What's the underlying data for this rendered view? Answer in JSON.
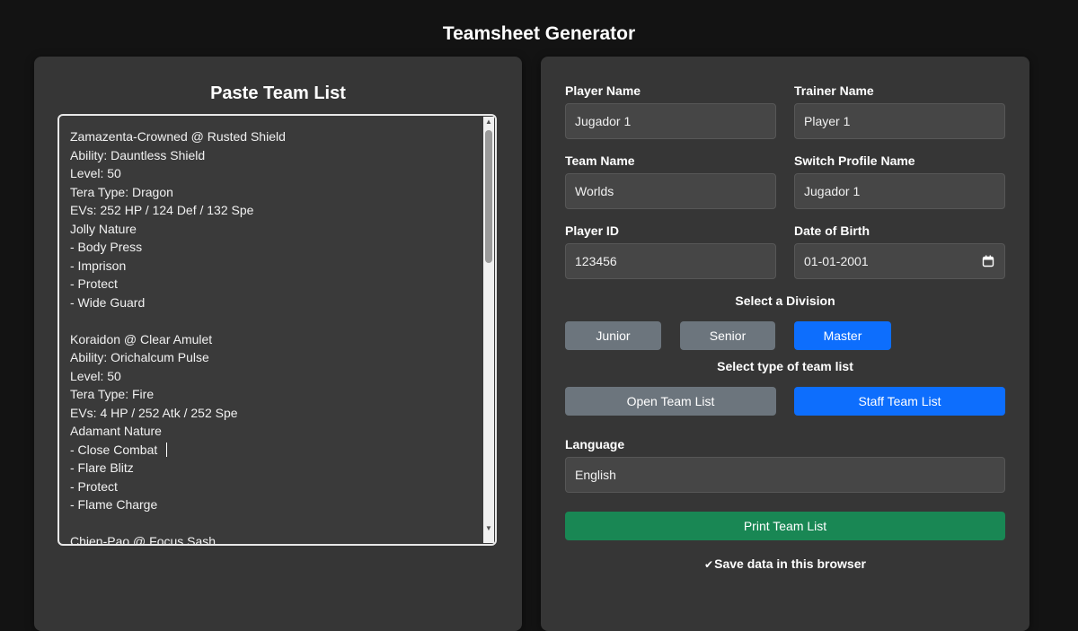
{
  "app": {
    "title": "Teamsheet Generator"
  },
  "team_panel": {
    "heading": "Paste Team List",
    "lines": [
      "Zamazenta-Crowned @ Rusted Shield",
      "Ability: Dauntless Shield",
      "Level: 50",
      "Tera Type: Dragon",
      "EVs: 252 HP / 124 Def / 132 Spe",
      "Jolly Nature",
      "- Body Press",
      "- Imprison",
      "- Protect",
      "- Wide Guard",
      "",
      "Koraidon @ Clear Amulet",
      "Ability: Orichalcum Pulse",
      "Level: 50",
      "Tera Type: Fire",
      "EVs: 4 HP / 252 Atk / 252 Spe",
      "Adamant Nature",
      "- Close Combat ",
      "- Flare Blitz",
      "- Protect",
      "- Flame Charge",
      "",
      "Chien-Pao @ Focus Sash"
    ]
  },
  "form": {
    "player_name": {
      "label": "Player Name",
      "value": "Jugador 1"
    },
    "trainer_name": {
      "label": "Trainer Name",
      "value": "Player 1"
    },
    "team_name": {
      "label": "Team Name",
      "value": "Worlds"
    },
    "switch_profile_name": {
      "label": "Switch Profile Name",
      "value": "Jugador 1"
    },
    "player_id": {
      "label": "Player ID",
      "value": "123456"
    },
    "date_of_birth": {
      "label": "Date of Birth",
      "value": "01-01-2001",
      "icon": "calendar-icon"
    },
    "division": {
      "label": "Select a Division",
      "options": [
        "Junior",
        "Senior",
        "Master"
      ],
      "selected": "Master"
    },
    "list_type": {
      "label": "Select type of team list",
      "options": [
        "Open Team List",
        "Staff Team List"
      ],
      "selected": "Staff Team List"
    },
    "language": {
      "label": "Language",
      "value": "English"
    },
    "print_button": "Print Team List",
    "save_checkbox": {
      "label": "Save data in this browser",
      "checked": true
    }
  },
  "colors": {
    "background": "#131313",
    "panel": "#363636",
    "accent_blue": "#0d6efd",
    "button_grey": "#6c757d",
    "button_green": "#198754"
  }
}
